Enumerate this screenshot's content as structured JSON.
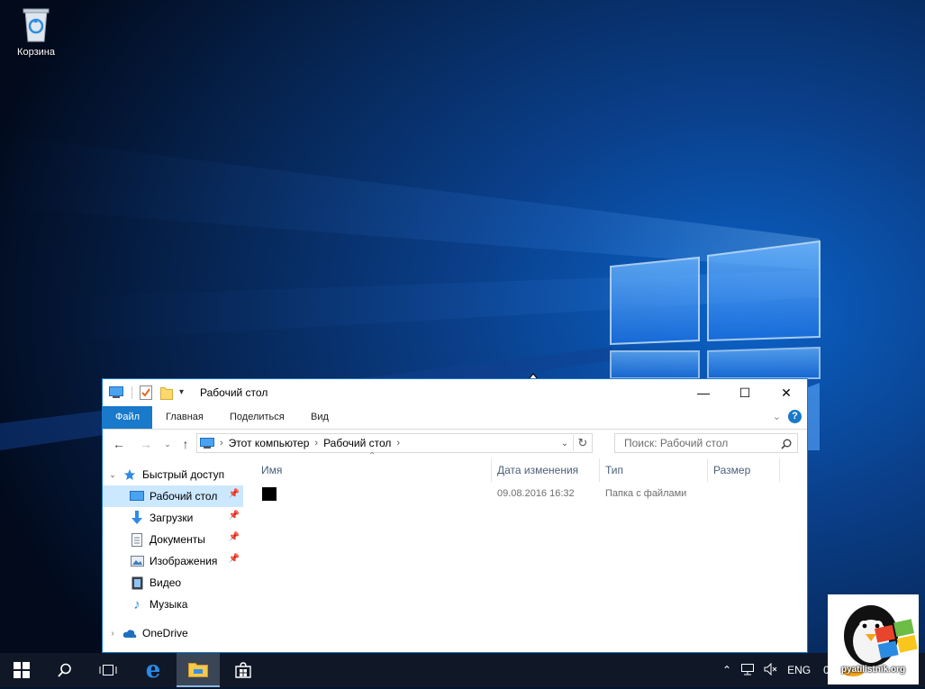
{
  "desktop": {
    "recycle_bin_label": "Корзина",
    "watermark_text": "pyatilistnik.org"
  },
  "window": {
    "title": "Рабочий стол",
    "controls": {
      "minimize": "—",
      "maximize": "☐",
      "close": "✕"
    },
    "ribbon_tabs": [
      "Файл",
      "Главная",
      "Поделиться",
      "Вид"
    ],
    "help_glyph": "?",
    "address": {
      "crumbs": [
        "Этот компьютер",
        "Рабочий стол"
      ]
    },
    "search_placeholder": "Поиск: Рабочий стол",
    "sidebar": [
      {
        "label": "Быстрый доступ",
        "icon": "star-icon",
        "pinned": false
      },
      {
        "label": "Рабочий стол",
        "icon": "desktop-icon",
        "pinned": true,
        "selected": true
      },
      {
        "label": "Загрузки",
        "icon": "download-arrow-icon",
        "pinned": true
      },
      {
        "label": "Документы",
        "icon": "document-icon",
        "pinned": true
      },
      {
        "label": "Изображения",
        "icon": "picture-icon",
        "pinned": true
      },
      {
        "label": "Видео",
        "icon": "film-icon",
        "pinned": false
      },
      {
        "label": "Музыка",
        "icon": "music-note-icon",
        "pinned": false
      },
      {
        "label": "OneDrive",
        "icon": "cloud-icon",
        "pinned": false
      }
    ],
    "columns": [
      "Имя",
      "Дата изменения",
      "Тип",
      "Размер"
    ],
    "files": [
      {
        "name": "",
        "modified": "09.08.2016 16:32",
        "type": "Папка с файлами",
        "size": ""
      }
    ]
  },
  "taskbar": {
    "language": "ENG",
    "clock_fragment": "0",
    "items": [
      "start-button",
      "search-button",
      "task-view-button",
      "edge-browser",
      "file-explorer",
      "windows-store"
    ]
  },
  "colors": {
    "accent": "#1979ca",
    "selection": "#cce8ff",
    "taskbar": "#101828"
  }
}
